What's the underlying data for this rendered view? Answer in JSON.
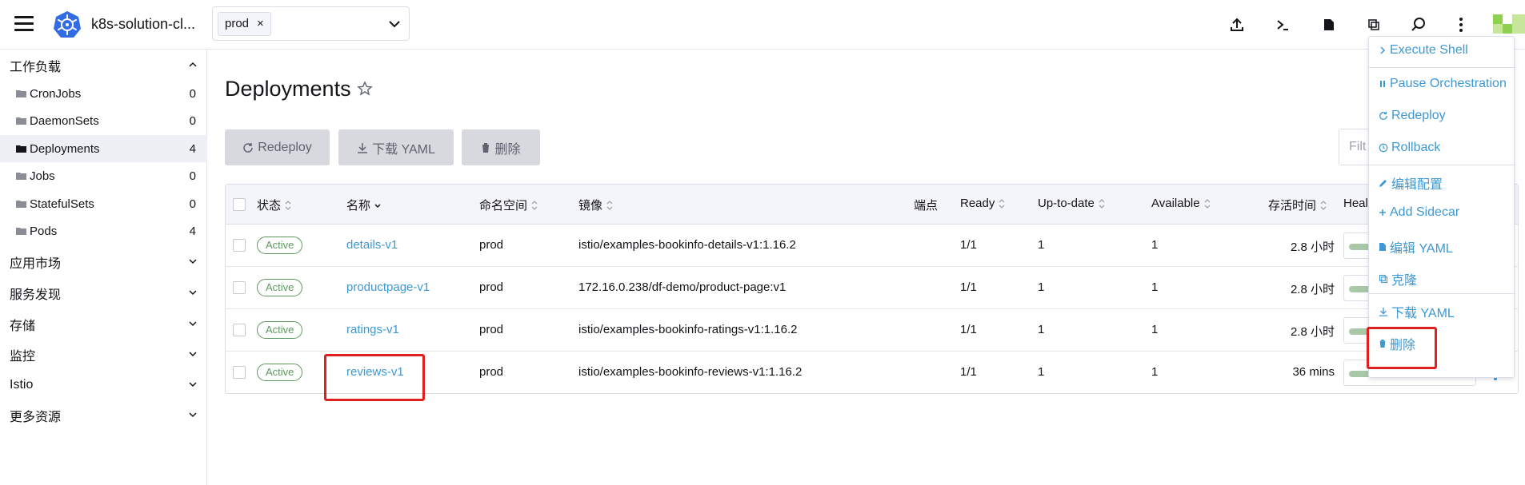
{
  "header": {
    "cluster_name": "k8s-solution-cl...",
    "namespace_chip": "prod",
    "chip_close": "×"
  },
  "sidebar": {
    "groups": [
      {
        "label": "工作负载",
        "expanded": true
      },
      {
        "label": "应用市场",
        "expanded": false
      },
      {
        "label": "服务发现",
        "expanded": false
      },
      {
        "label": "存储",
        "expanded": false
      },
      {
        "label": "监控",
        "expanded": false
      },
      {
        "label": "Istio",
        "expanded": false
      },
      {
        "label": "更多资源",
        "expanded": false
      }
    ],
    "workload_items": [
      {
        "label": "CronJobs",
        "count": "0",
        "active": false
      },
      {
        "label": "DaemonSets",
        "count": "0",
        "active": false
      },
      {
        "label": "Deployments",
        "count": "4",
        "active": true
      },
      {
        "label": "Jobs",
        "count": "0",
        "active": false
      },
      {
        "label": "StatefulSets",
        "count": "0",
        "active": false
      },
      {
        "label": "Pods",
        "count": "4",
        "active": false
      }
    ]
  },
  "main": {
    "title": "Deployments",
    "buttons": {
      "redeploy": "Redeploy",
      "download_yaml": "下载 YAML",
      "delete": "删除"
    },
    "filter_placeholder": "Filt"
  },
  "table": {
    "columns": {
      "state": "状态",
      "name": "名称",
      "namespace": "命名空间",
      "image": "镜像",
      "endpoints": "端点",
      "ready": "Ready",
      "uptodate": "Up-to-date",
      "available": "Available",
      "age": "存活时间",
      "health": "Healt"
    },
    "rows": [
      {
        "state": "Active",
        "name": "details-v1",
        "namespace": "prod",
        "image": "istio/examples-bookinfo-details-v1:1.16.2",
        "ready": "1/1",
        "uptodate": "1",
        "available": "1",
        "age": "2.8 小时"
      },
      {
        "state": "Active",
        "name": "productpage-v1",
        "namespace": "prod",
        "image": "172.16.0.238/df-demo/product-page:v1",
        "ready": "1/1",
        "uptodate": "1",
        "available": "1",
        "age": "2.8 小时"
      },
      {
        "state": "Active",
        "name": "ratings-v1",
        "namespace": "prod",
        "image": "istio/examples-bookinfo-ratings-v1:1.16.2",
        "ready": "1/1",
        "uptodate": "1",
        "available": "1",
        "age": "2.8 小时"
      },
      {
        "state": "Active",
        "name": "reviews-v1",
        "namespace": "prod",
        "image": "istio/examples-bookinfo-reviews-v1:1.16.2",
        "ready": "1/1",
        "uptodate": "1",
        "available": "1",
        "age": "36 mins"
      }
    ]
  },
  "menu": {
    "execute_shell": "Execute Shell",
    "pause": "Pause Orchestration",
    "redeploy": "Redeploy",
    "rollback": "Rollback",
    "edit_config": "编辑配置",
    "add_sidecar": "Add Sidecar",
    "edit_yaml": "编辑 YAML",
    "clone": "克隆",
    "download_yaml": "下载 YAML",
    "delete": "删除"
  },
  "colors": {
    "link": "#3d98d3",
    "active_badge": "#5d995d",
    "highlight": "#e0201f",
    "button_bg": "#d7d9de"
  }
}
